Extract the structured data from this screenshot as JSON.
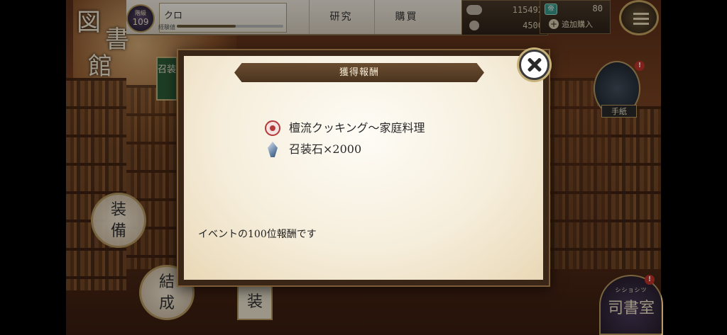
{
  "header": {
    "logo": [
      "図",
      "書",
      "館"
    ],
    "level_label": "階級",
    "level": "109",
    "player_name": "クロ",
    "exp_label": "経験値",
    "tabs": [
      "研究",
      "購買"
    ],
    "currency_1": "115492",
    "currency_2": "4500",
    "gem_icon": "帝",
    "gems": "80",
    "add_purchase": "追加購入"
  },
  "side": {
    "summon_tag": "召装",
    "equip": [
      "装",
      "備"
    ],
    "combine": [
      "結",
      "成"
    ],
    "bottom_tag": "装",
    "letters_label": "手紙",
    "office_small": "シショシツ",
    "office_label": "司書室",
    "notify_mark": "!"
  },
  "modal": {
    "title": "獲得報酬",
    "rewards": [
      {
        "icon": "seal-icon",
        "label": "檀流クッキング〜家庭料理"
      },
      {
        "icon": "summon-stone-icon",
        "label": "召装石×2000"
      }
    ],
    "message": "イベントの100位報酬です"
  },
  "colors": {
    "banner": "#5a3e25",
    "modal_bg": "#f6eedc",
    "accent_gold": "#c9b27a",
    "notify_red": "#c7342a"
  }
}
